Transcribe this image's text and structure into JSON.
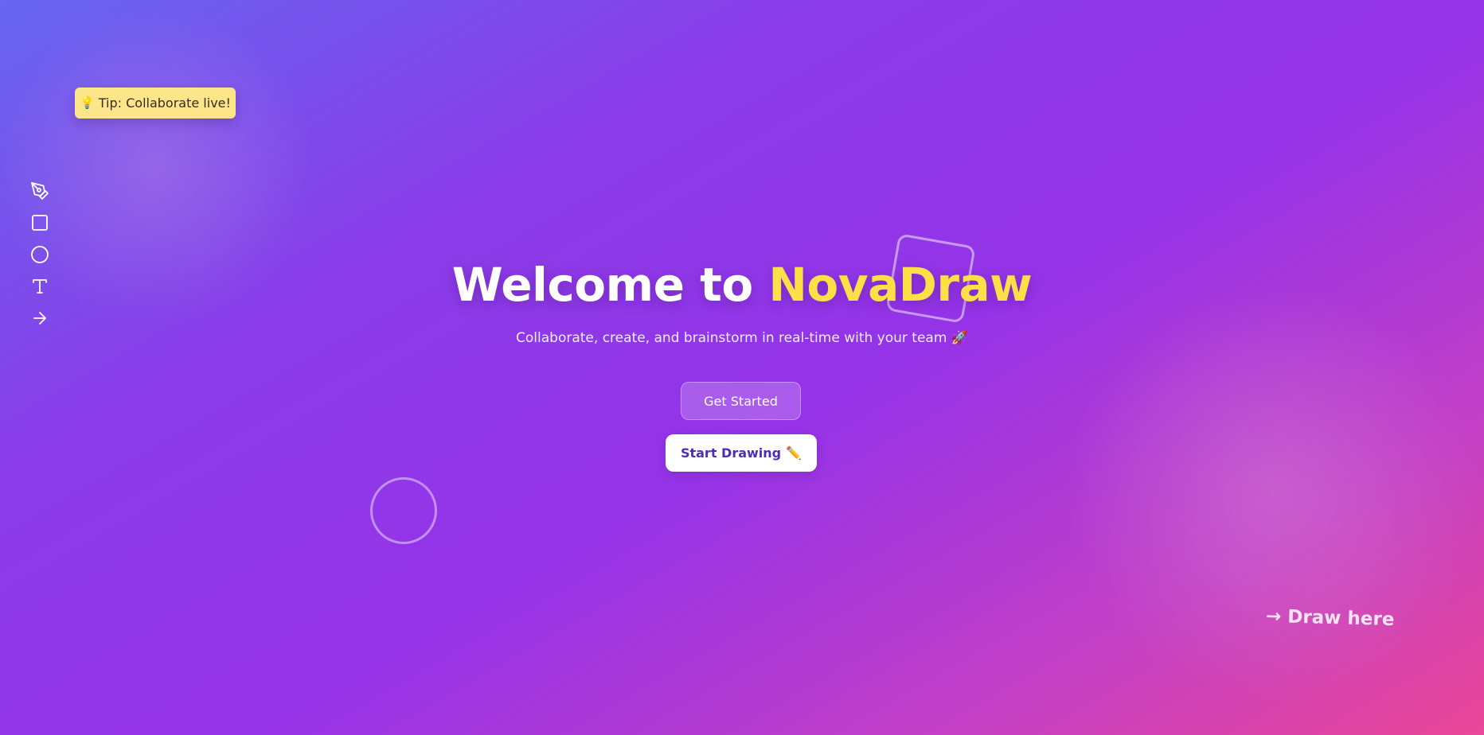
{
  "tip": {
    "icon": "lightbulb-icon",
    "text": "Tip: Collaborate live!"
  },
  "toolbar": {
    "tools": [
      {
        "icon": "pen-tool-icon"
      },
      {
        "icon": "rectangle-icon"
      },
      {
        "icon": "circle-icon"
      },
      {
        "icon": "text-icon"
      },
      {
        "icon": "arrow-right-icon"
      }
    ]
  },
  "hero": {
    "title_prefix": "Welcome to ",
    "brand": "NovaDraw",
    "subtitle": "Collaborate, create, and brainstorm in real-time with your team 🚀",
    "primary_button": "Get Started",
    "secondary_button": "Start Drawing",
    "secondary_button_icon": "✏️"
  },
  "canvas_hint": "→ Draw here",
  "colors": {
    "brand_accent": "#fde047",
    "tip_background": "#fde68a",
    "secondary_button_text": "#4c2db8",
    "gradient_start": "#6666f0",
    "gradient_mid": "#9533e8",
    "gradient_end": "#ea4797"
  }
}
